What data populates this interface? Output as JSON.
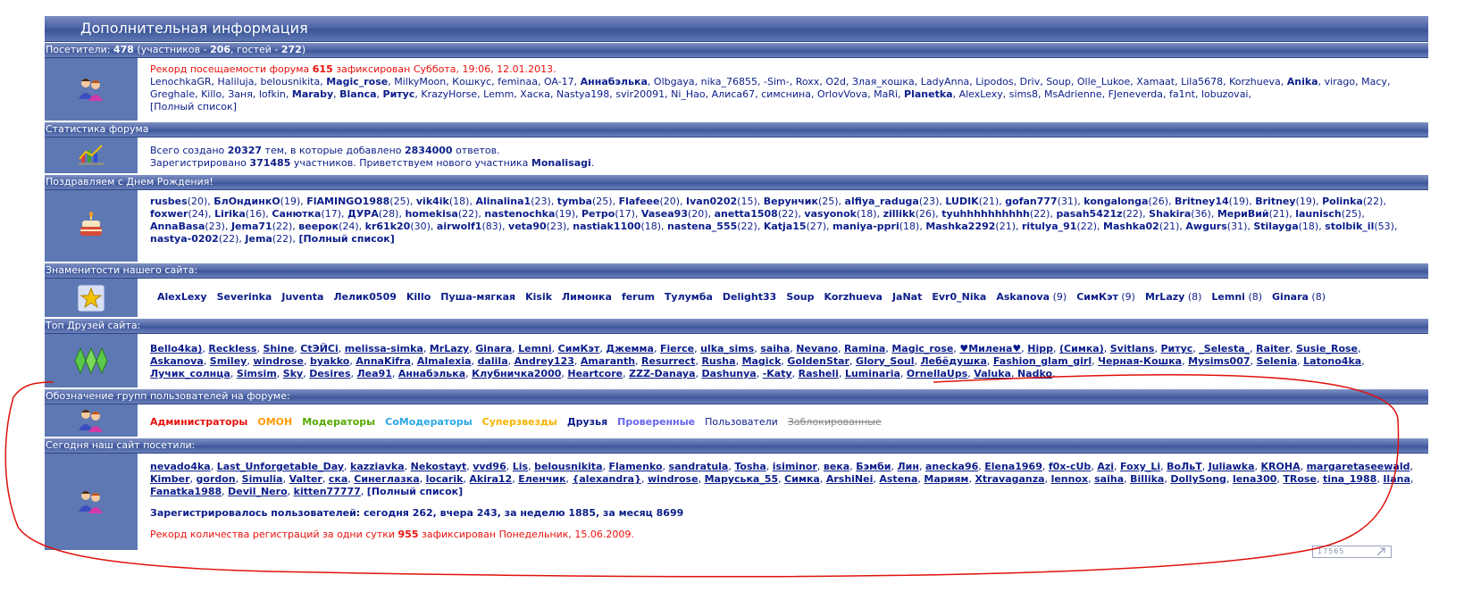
{
  "title": "Дополнительная информация",
  "visitors": {
    "header": {
      "prefix": "Посетители: ",
      "total": "478",
      "mid": "  (участников - ",
      "members": "206",
      "sep": ", гостей - ",
      "guests": "272",
      "end": ")"
    },
    "record": {
      "pre": "Рекорд посещаемости форума ",
      "count": "615",
      "post": " зафиксирован Суббота, 19:06, 12.01.2013."
    },
    "users": [
      {
        "n": "LenochkaGR",
        "c": "blk"
      },
      {
        "n": "Haliluja",
        "c": "blk"
      },
      {
        "n": "belousnikita",
        "c": "violet"
      },
      {
        "n": "Magic_rose",
        "c": "navy bold"
      },
      {
        "n": "MilkyMoon",
        "c": "blk"
      },
      {
        "n": "Кошкус",
        "c": "violet"
      },
      {
        "n": "feminaa",
        "c": "blk"
      },
      {
        "n": "OA-17",
        "c": "violet"
      },
      {
        "n": "Аннабэлька",
        "c": "navy bold"
      },
      {
        "n": "Olbgaya",
        "c": "violet"
      },
      {
        "n": "nika_76855",
        "c": "blk"
      },
      {
        "n": "-Sim-",
        "c": "violet"
      },
      {
        "n": "Roxx",
        "c": "green"
      },
      {
        "n": "O2d",
        "c": "violet"
      },
      {
        "n": "Злая_кошка",
        "c": "violet"
      },
      {
        "n": "LadyAnna",
        "c": "violet"
      },
      {
        "n": "Lipodos",
        "c": "violet"
      },
      {
        "n": "Driv",
        "c": "violet"
      },
      {
        "n": "Soup",
        "c": "gold"
      },
      {
        "n": "Olle_Lukoe",
        "c": "violet"
      },
      {
        "n": "Xamaat",
        "c": "violet"
      },
      {
        "n": "Lila5678",
        "c": "violet"
      },
      {
        "n": "Korzhueva",
        "c": "gold"
      },
      {
        "n": "Anika",
        "c": "navy bold"
      },
      {
        "n": "virago",
        "c": "violet"
      },
      {
        "n": "Macy",
        "c": "violet"
      },
      {
        "n": "Greghale",
        "c": "violet"
      },
      {
        "n": "Killo",
        "c": "gold"
      },
      {
        "n": "Заня",
        "c": "violet"
      },
      {
        "n": "lofkin",
        "c": "blk"
      },
      {
        "n": "Maraby",
        "c": "navy bold"
      },
      {
        "n": "Blanca",
        "c": "navy bold"
      },
      {
        "n": "Ритус",
        "c": "navy bold"
      },
      {
        "n": "KrazyHorse",
        "c": "violet"
      },
      {
        "n": "Lemm",
        "c": "violet"
      },
      {
        "n": "Хаска",
        "c": "violet"
      },
      {
        "n": "Nastya198",
        "c": "blk"
      },
      {
        "n": "svir20091",
        "c": "violet"
      },
      {
        "n": "Ni_Hao",
        "c": "violet"
      },
      {
        "n": "Алиса67",
        "c": "violet"
      },
      {
        "n": "симснина",
        "c": "violet"
      },
      {
        "n": "OrlovVova",
        "c": "violet"
      },
      {
        "n": "MaRi",
        "c": "violet"
      },
      {
        "n": "Planetka",
        "c": "navy bold"
      },
      {
        "n": "AlexLexy",
        "c": "gold"
      },
      {
        "n": "sims8",
        "c": "violet"
      },
      {
        "n": "MsAdrienne",
        "c": "green"
      },
      {
        "n": "FJeneverda",
        "c": "violet"
      },
      {
        "n": "fa1nt",
        "c": "blk"
      },
      {
        "n": "lobuzovai",
        "c": "blk"
      }
    ],
    "full_list": "[Полный список]"
  },
  "stats": {
    "header": "Статистика форума",
    "line1": {
      "a": "Всего создано ",
      "topics": "20327",
      "b": " тем, в которые добавлено ",
      "posts": "2834000",
      "c": " ответов."
    },
    "line2": {
      "a": "Зарегистрировано ",
      "users": "371485",
      "b": " участников. Приветствуем нового участника ",
      "newest": "Monalisagi",
      "c": "."
    }
  },
  "birthdays": {
    "header": "Поздравляем с Днем Рождения!",
    "people": [
      [
        "rusbes",
        "20"
      ],
      [
        "БлОндинкО",
        "19"
      ],
      [
        "FlAMINGO1988",
        "25"
      ],
      [
        "vik4ik",
        "18"
      ],
      [
        "Alinalina1",
        "23"
      ],
      [
        "tymba",
        "25"
      ],
      [
        "Flafeee",
        "20"
      ],
      [
        "Ivan0202",
        "15"
      ],
      [
        "Верунчик",
        "25"
      ],
      [
        "alfiya_raduga",
        "23"
      ],
      [
        "LUDIK",
        "21"
      ],
      [
        "gofan777",
        "31"
      ],
      [
        "kongalonga",
        "26"
      ],
      [
        "Britney14",
        "19"
      ],
      [
        "Britney",
        "19"
      ],
      [
        "Polinka",
        "22"
      ],
      [
        "foxwer",
        "24"
      ],
      [
        "Lirika",
        "16"
      ],
      [
        "Санютка",
        "17"
      ],
      [
        "ДУРА",
        "28"
      ],
      [
        "homekisa",
        "22"
      ],
      [
        "nastenochka",
        "19"
      ],
      [
        "Ретро",
        "17"
      ],
      [
        "Vasea93",
        "20"
      ],
      [
        "anetta1508",
        "22"
      ],
      [
        "vasyonok",
        "18"
      ],
      [
        "zillikk",
        "26"
      ],
      [
        "tyuhhhhhhhhhh",
        "22"
      ],
      [
        "pasah5421z",
        "22"
      ],
      [
        "Shakira",
        "36"
      ],
      [
        "МериВий",
        "21"
      ],
      [
        "launisch",
        "25"
      ],
      [
        "AnnaBasa",
        "23"
      ],
      [
        "Jema71",
        "22"
      ],
      [
        "веерок",
        "24"
      ],
      [
        "kr61k20",
        "30"
      ],
      [
        "airwolf1",
        "83"
      ],
      [
        "veta90",
        "23"
      ],
      [
        "nastiak1100",
        "18"
      ],
      [
        "nastena_555",
        "22"
      ],
      [
        "Katja15",
        "27"
      ],
      [
        "maniya-ppri",
        "18"
      ],
      [
        "Mashka2292",
        "21"
      ],
      [
        "ritulya_91",
        "22"
      ],
      [
        "Mashka02",
        "21"
      ],
      [
        "Awgurs",
        "31"
      ],
      [
        "Stilayga",
        "18"
      ],
      [
        "stolbik_il",
        "53"
      ],
      [
        "nastya-0202",
        "22"
      ],
      [
        "Jema",
        "22"
      ]
    ],
    "full_list": "[Полный список]"
  },
  "celebs": {
    "header": "Знаменитости нашего сайта:",
    "gold": [
      "AlexLexy",
      "Severinka",
      "Juventa",
      "Лелик0509",
      "Killo",
      "Пуша-мягкая",
      "Kisik",
      "Лимонка",
      "ferum",
      "Тулумба",
      "Delight33",
      "Soup",
      "Korzhueva",
      "JaNat",
      "Evr0_Nika"
    ],
    "navy": [
      [
        "Askanova",
        "(9)"
      ],
      [
        "СимКэт",
        "(9)"
      ],
      [
        "MrLazy",
        "(8)"
      ],
      [
        "Lemni",
        "(8)"
      ],
      [
        "Ginara",
        "(8)"
      ]
    ]
  },
  "friends": {
    "header": "Топ Друзей сайта:",
    "list": [
      "Bello4ka)",
      "Reckless",
      "Shine",
      "CtЭЙСі",
      "melissa-simka",
      "MrLazy",
      "Ginara",
      "Lemni",
      "СимКэт",
      "Джемма",
      "Fierce",
      "ulka_sims",
      "saiha",
      "Nevano",
      "Ramina",
      "Magic_rose",
      "♥Милена♥",
      "Hipp",
      "(Симка)",
      "Svitlans",
      "Ритус",
      "_Selesta_",
      "Raiter",
      "Susie_Rose",
      "Askanova",
      "Smiley",
      "windrose",
      "byakko",
      "AnnaKifra",
      "Almalexia",
      "dalila",
      "Andrey123",
      "Amaranth",
      "Resurrect",
      "Rusha",
      "Magick",
      "GoldenStar",
      "Glory_Soul",
      "Лебёдушка",
      "Fashion_glam_girl",
      "Черная-Кошка",
      "Mysims007",
      "Selenia",
      "Latono4ka",
      "Лучик_солнца",
      "Simsim",
      "Sky",
      "Desires",
      "Леа91",
      "Аннабэлька",
      "Клубничка2000",
      "Heartcore",
      "ZZZ-Danaya",
      "Dashunya",
      "-Katy",
      "Rasheli",
      "Luminaria",
      "OrnellaUps",
      "Valuka",
      "Nadko"
    ]
  },
  "groups": {
    "header": "Обозначение групп пользователей на форуме:",
    "items": [
      {
        "n": "Администраторы",
        "c": "red bold"
      },
      {
        "n": "ОМОН",
        "c": "orange bold"
      },
      {
        "n": "Модераторы",
        "c": "dgrn bold"
      },
      {
        "n": "СоМодераторы",
        "c": "lblue bold"
      },
      {
        "n": "Суперзвезды",
        "c": "gold bold"
      },
      {
        "n": "Друзья",
        "c": "navy bold"
      },
      {
        "n": "Проверенные",
        "c": "violet bold"
      },
      {
        "n": "Пользователи",
        "c": "navy"
      },
      {
        "n": "Заблокированные",
        "c": "grey strike"
      }
    ]
  },
  "today": {
    "header": "Сегодня наш сайт посетили:",
    "list": [
      "nevado4ka",
      "Last_Unforgetable_Day",
      "kazziavka",
      "Nekostayt",
      "vvd96",
      "Lis",
      "belousnikita",
      "Flamenko",
      "sandratula",
      "Tosha",
      "isiminor",
      "века",
      "Бэмби",
      "Лин",
      "anecka96",
      "Elena1969",
      "f0x-cUb",
      "Azi",
      "Foxy_Li",
      "ВоЛьТ",
      "Juliawka",
      "KROHA",
      "margaretaseewald",
      "Kimber",
      "gordon",
      "Simulia",
      "Valter",
      "ска",
      "Синеглазка",
      "locarik",
      "Akira12",
      "Еленчик",
      "{alexandra}",
      "windrose",
      "Маруська_55",
      "Симка",
      "ArshiNei",
      "Astena",
      "Мариям",
      "Xtravaganza",
      "lennox",
      "saiha",
      "Billika",
      "DollySong",
      "lena300",
      "TRose",
      "tina_1988",
      "Ilana",
      "Fanatka1988",
      "Devil_Nero",
      "kitten77777"
    ],
    "full_list": "[Полный список]",
    "registered": "Зарегистрировалось пользователей: сегодня 262, вчера 243, за неделю 1885, за месяц 8699",
    "reg_record": {
      "pre": "Рекорд количества регистраций за одни сутки ",
      "count": "955",
      "post": " зафиксирован Понедельник, 15.06.2009."
    }
  },
  "counter": "17565"
}
